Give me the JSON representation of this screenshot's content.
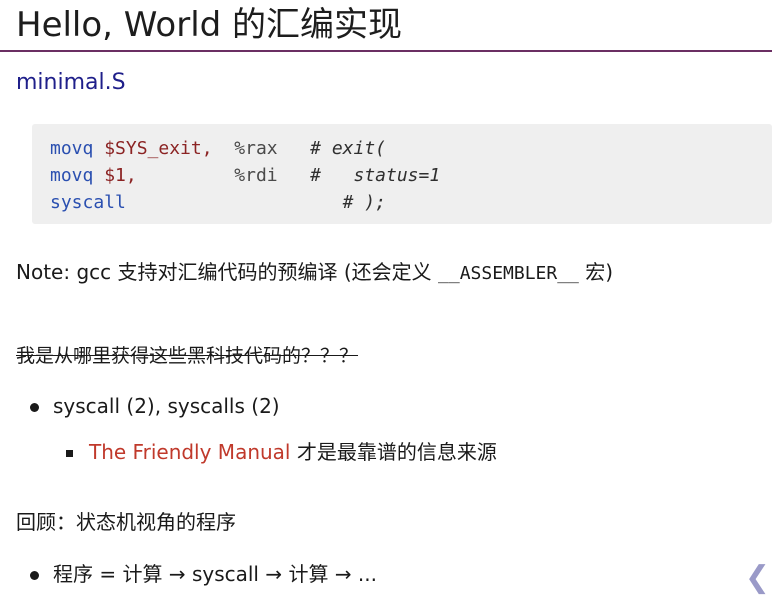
{
  "slide": {
    "title": "Hello, World 的汇编实现",
    "subtitle": "minimal.S",
    "code": [
      {
        "op": "movq",
        "arg": "$SYS_exit,",
        "reg": "%rax",
        "comment": "# exit("
      },
      {
        "op": "movq",
        "arg": "$1,",
        "reg": "%rdi",
        "comment": "#   status=1"
      },
      {
        "op": "syscall",
        "arg": "",
        "reg": "",
        "comment": "# );"
      }
    ],
    "note_prefix": "Note: gcc 支持对汇编代码的预编译 (还会定义 ",
    "note_mono": "__ASSEMBLER__",
    "note_suffix": " 宏)",
    "struck_question": "我是从哪里获得这些黑科技代码的？？？",
    "bullet1": "syscall (2), syscalls (2)",
    "subbullet_link": "The Friendly Manual",
    "subbullet_text": " 才是最靠谱的信息来源",
    "section_heading": "回顾：状态机视角的程序",
    "bullet2": "程序 = 计算 → syscall → 计算 → ..."
  },
  "nav": {
    "arrow_icon": "chevron-left-icon"
  }
}
